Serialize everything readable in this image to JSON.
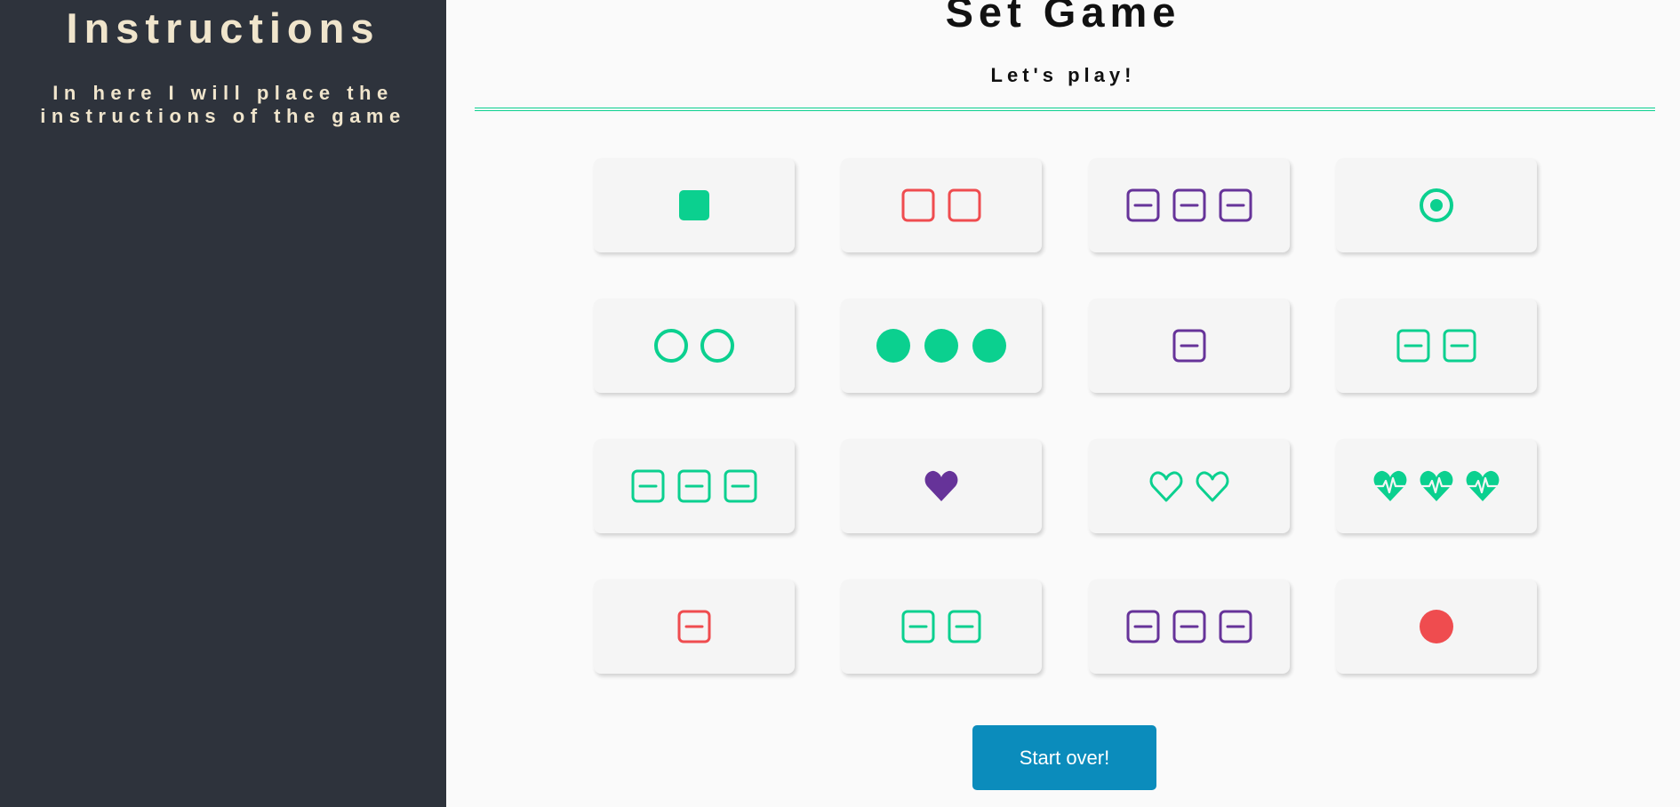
{
  "sidebar": {
    "title": "Instructions",
    "text": "In here I will place the instructions of the game"
  },
  "header": {
    "title": "Set Game",
    "subtitle": "Let's play!"
  },
  "colors": {
    "green": "#0bd08f",
    "red": "#ef4c4f",
    "purple": "#663399",
    "sidebar_bg": "#2e333c",
    "sidebar_text": "#f0e5cc",
    "button": "#0b8cbc"
  },
  "cards": [
    {
      "shape": "square",
      "count": 1,
      "color": "green",
      "fill": "solid"
    },
    {
      "shape": "square",
      "count": 2,
      "color": "red",
      "fill": "outline"
    },
    {
      "shape": "minus-square",
      "count": 3,
      "color": "purple",
      "fill": "outline"
    },
    {
      "shape": "dot-circle",
      "count": 1,
      "color": "green",
      "fill": "outline"
    },
    {
      "shape": "circle",
      "count": 2,
      "color": "green",
      "fill": "outline"
    },
    {
      "shape": "circle",
      "count": 3,
      "color": "green",
      "fill": "solid"
    },
    {
      "shape": "minus-square",
      "count": 1,
      "color": "purple",
      "fill": "outline"
    },
    {
      "shape": "minus-square",
      "count": 2,
      "color": "green",
      "fill": "outline"
    },
    {
      "shape": "minus-square",
      "count": 3,
      "color": "green",
      "fill": "outline"
    },
    {
      "shape": "heart",
      "count": 1,
      "color": "purple",
      "fill": "solid"
    },
    {
      "shape": "heart",
      "count": 2,
      "color": "green",
      "fill": "outline"
    },
    {
      "shape": "heartbeat",
      "count": 3,
      "color": "green",
      "fill": "solid"
    },
    {
      "shape": "minus-square",
      "count": 1,
      "color": "red",
      "fill": "outline"
    },
    {
      "shape": "minus-square",
      "count": 2,
      "color": "green",
      "fill": "outline"
    },
    {
      "shape": "minus-square",
      "count": 3,
      "color": "purple",
      "fill": "outline"
    },
    {
      "shape": "circle",
      "count": 1,
      "color": "red",
      "fill": "solid"
    }
  ],
  "button": {
    "label": "Start over!"
  }
}
